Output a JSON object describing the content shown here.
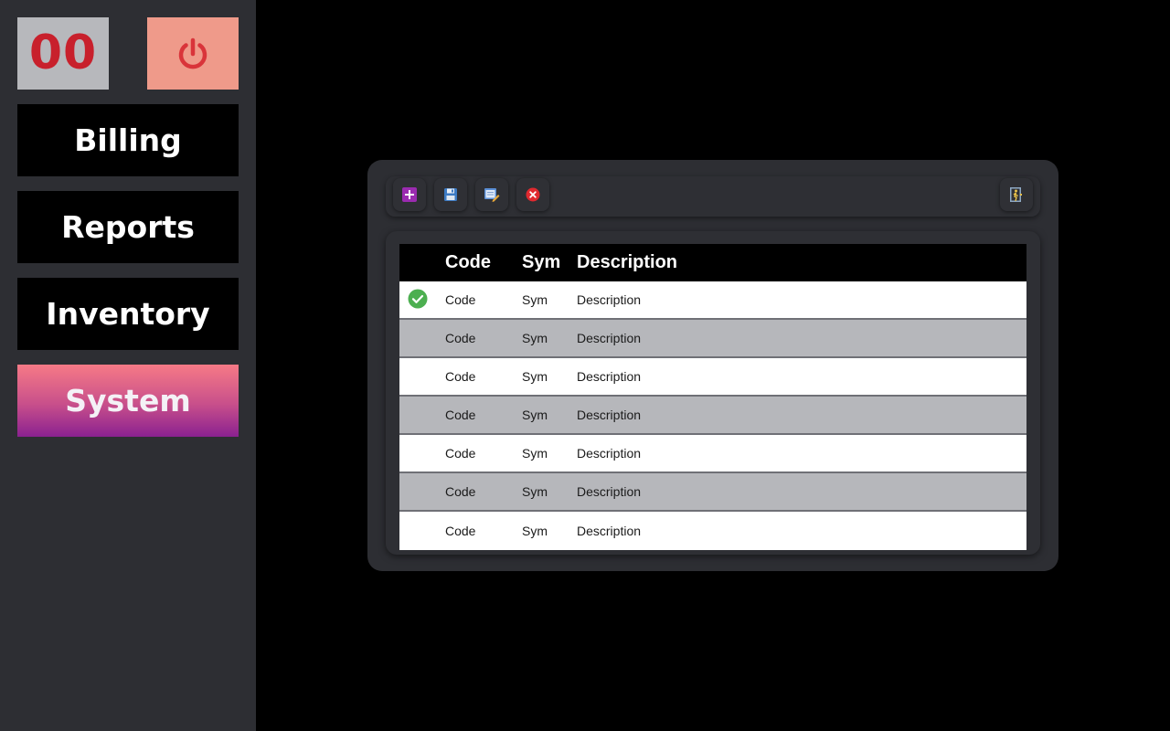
{
  "counter": {
    "value": "00"
  },
  "nav": {
    "items": [
      {
        "label": "Billing"
      },
      {
        "label": "Reports"
      },
      {
        "label": "Inventory"
      },
      {
        "label": "System"
      }
    ],
    "active": "System"
  },
  "toolbar": {
    "icons": [
      "add-icon",
      "save-icon",
      "edit-icon",
      "delete-icon",
      "exit-icon"
    ]
  },
  "table": {
    "headers": {
      "code": "Code",
      "sym": "Sym",
      "description": "Description"
    },
    "rows": [
      {
        "code": "Code",
        "sym": "Sym",
        "description": "Description",
        "selected": true
      },
      {
        "code": "Code",
        "sym": "Sym",
        "description": "Description"
      },
      {
        "code": "Code",
        "sym": "Sym",
        "description": "Description"
      },
      {
        "code": "Code",
        "sym": "Sym",
        "description": "Description"
      },
      {
        "code": "Code",
        "sym": "Sym",
        "description": "Description"
      },
      {
        "code": "Code",
        "sym": "Sym",
        "description": "Description"
      },
      {
        "code": "Code",
        "sym": "Sym",
        "description": "Description"
      }
    ]
  },
  "colors": {
    "sidebar_bg": "#2d2e33",
    "counter_text": "#c8202c",
    "power_bg": "#ef9a8a",
    "active_gradient_top": "#f67a86",
    "active_gradient_bottom": "#8a2190",
    "check_green": "#4caf50"
  }
}
